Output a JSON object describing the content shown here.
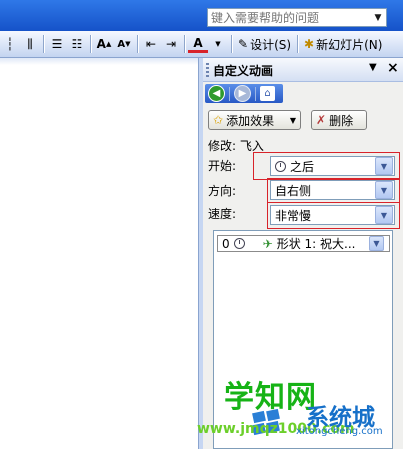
{
  "help": {
    "placeholder": "键入需要帮助的问题"
  },
  "toolbar": {
    "design_label": "设计(S)",
    "new_slide_label": "新幻灯片(N)"
  },
  "task_pane": {
    "title": "自定义动画",
    "add_effect_label": "添加效果",
    "remove_label": "删除",
    "modify_text": "修改: 飞入",
    "start_label": "开始:",
    "start_value": "之后",
    "direction_label": "方向:",
    "direction_value": "自右侧",
    "speed_label": "速度:",
    "speed_value": "非常慢",
    "list": [
      {
        "order": "0",
        "text": "形状 1: 祝大..."
      }
    ]
  },
  "watermark": {
    "main": "学知网",
    "url": "www.jmqz1000.com",
    "brand": "系统城",
    "brand_url": "xitongcheng.com"
  },
  "colors": {
    "highlight": "#d8232a",
    "title_bar": "#1552c9",
    "watermark_green": "#16b316",
    "watermark_blue": "#1670c9"
  }
}
